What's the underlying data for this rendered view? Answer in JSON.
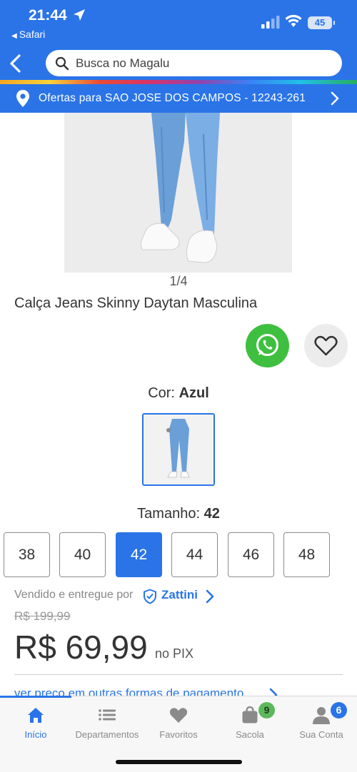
{
  "status_bar": {
    "time": "21:44",
    "back_app": "Safari",
    "battery": "45"
  },
  "header": {
    "search_placeholder": "Busca no Magalu",
    "location_text": "Ofertas para SAO JOSE DOS CAMPOS - 12243-261"
  },
  "product": {
    "image_counter": "1/4",
    "title": "Calça Jeans Skinny Daytan Masculina",
    "color_label": "Cor:",
    "color_value": "Azul",
    "size_label": "Tamanho:",
    "size_value": "42",
    "sizes": [
      "38",
      "40",
      "42",
      "44",
      "46",
      "48"
    ],
    "selected_size": "42"
  },
  "seller": {
    "label": "Vendido e entregue por",
    "name": "Zattini"
  },
  "pricing": {
    "old_price": "R$ 199,99",
    "price": "R$ 69,99",
    "price_suffix": "no PIX",
    "other_payments": "ver preço em outras formas de pagamento"
  },
  "tabbar": {
    "tabs": [
      {
        "label": "Início",
        "icon": "home-icon",
        "active": true
      },
      {
        "label": "Departamentos",
        "icon": "list-icon",
        "active": false
      },
      {
        "label": "Favoritos",
        "icon": "heart-icon",
        "active": false
      },
      {
        "label": "Sacola",
        "icon": "bag-icon",
        "active": false,
        "badge": "9"
      },
      {
        "label": "Sua Conta",
        "icon": "user-icon",
        "active": false,
        "badge": "6"
      }
    ]
  },
  "colors": {
    "brand_blue": "#2a74e8",
    "whatsapp_green": "#3fbf3f",
    "badge_green": "#5cb85c"
  }
}
